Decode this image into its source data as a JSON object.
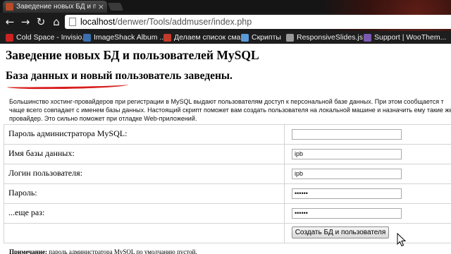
{
  "browser": {
    "tab_title": "Заведение новых БД и по",
    "tab_close": "×",
    "url_host": "localhost",
    "url_path": "/denwer/Tools/addmuser/index.php",
    "nav": {
      "back": "←",
      "forward": "→",
      "reload": "↻",
      "home": "⌂"
    },
    "bookmarks": [
      {
        "label": "Cold Space - Invisio...",
        "icon_color": "#cc2222"
      },
      {
        "label": "ImageShack Album ...",
        "icon_color": "#3a6fb0"
      },
      {
        "label": "Делаем список сма...",
        "icon_color": "#c23b2a"
      },
      {
        "label": "Скрипты",
        "icon_color": "#5a9ad8"
      },
      {
        "label": "ResponsiveSlides.js ...",
        "icon_color": "#9a9a9a"
      },
      {
        "label": "Support | WooThem...",
        "icon_color": "#7a5ab0"
      }
    ]
  },
  "page": {
    "title": "Заведение новых БД и пользователей MySQL",
    "success_message": "База данных и новый пользователь заведены.",
    "intro_lines": [
      "Большинство хостинг-провайдеров при регистрации в MySQL выдают пользователям доступ к персональной базе данных. При этом сообщается т",
      "чаще всего совпадает с именем базы данных. Настоящий скрипт поможет вам создать пользователя на локальной машине и назначить ему такие же",
      "провайдер. Это сильно поможет при отладке Web-приложений."
    ],
    "form": {
      "fields": [
        {
          "label": "Пароль администратора MySQL:",
          "value": ""
        },
        {
          "label": "Имя базы данных:",
          "value": "ipb"
        },
        {
          "label": "Логин пользователя:",
          "value": "ipb"
        },
        {
          "label": "Пароль:",
          "value": "••••••"
        },
        {
          "label": "...еще раз:",
          "value": "••••••"
        }
      ],
      "submit_label": "Создать БД и пользователя"
    },
    "note_bold": "Примечание:",
    "note_text": " пароль администратора MySQL по умолчанию пустой."
  },
  "colors": {
    "underline": "#d81d1d",
    "chrome_bg": "#1b1b1b"
  }
}
